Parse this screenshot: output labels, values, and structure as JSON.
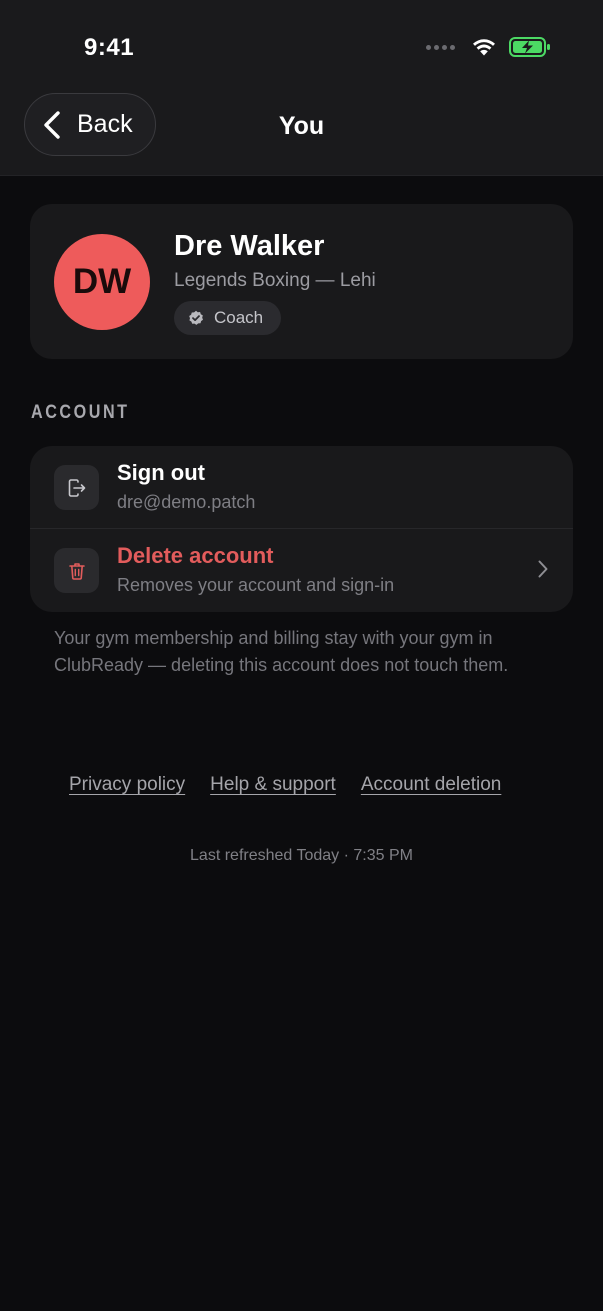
{
  "status_bar": {
    "time": "9:41"
  },
  "nav": {
    "back_label": "Back",
    "title": "You"
  },
  "profile": {
    "initials": "DW",
    "name": "Dre Walker",
    "gym": "Legends Boxing — Lehi",
    "role": "Coach",
    "avatar_color": "#ee5b5b"
  },
  "account": {
    "section_label": "ACCOUNT",
    "sign_out": {
      "title": "Sign out",
      "subtitle": "dre@demo.patch",
      "icon": "sign-out-icon"
    },
    "delete": {
      "title": "Delete account",
      "subtitle": "Removes your account and sign-in",
      "icon": "trash-icon",
      "color": "#e25c5c"
    },
    "footnote": "Your gym membership and billing stay with your gym in ClubReady — deleting this account does not touch them."
  },
  "links": {
    "privacy": "Privacy policy",
    "help": "Help & support",
    "deletion": "Account deletion"
  },
  "footer": {
    "last_refreshed": "Last refreshed Today · 7:35 PM"
  },
  "colors": {
    "background": "#0c0c0e",
    "card": "#19191b",
    "battery": "#4cd964"
  }
}
